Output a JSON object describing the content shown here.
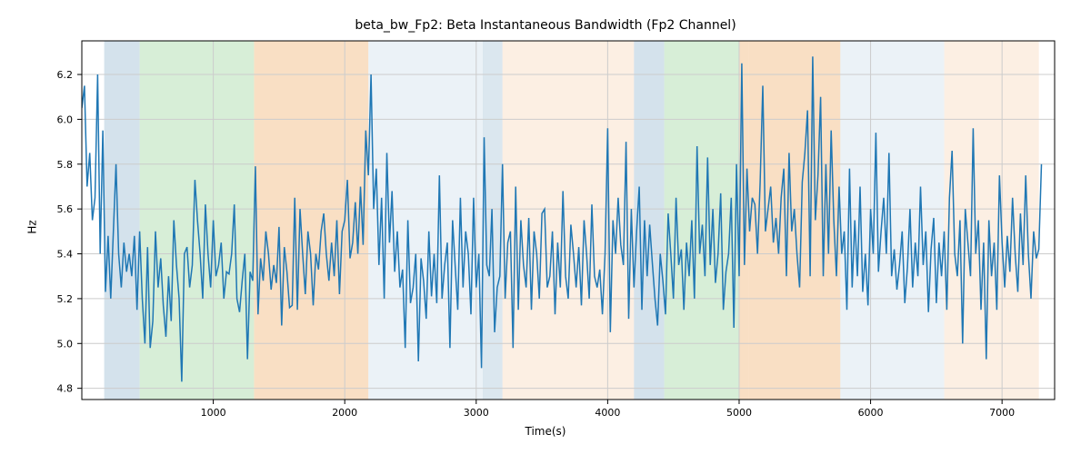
{
  "chart_data": {
    "type": "line",
    "title": "beta_bw_Fp2: Beta Instantaneous Bandwidth (Fp2 Channel)",
    "xlabel": "Time(s)",
    "ylabel": "Hz",
    "xlim": [
      0,
      7400
    ],
    "ylim": [
      4.75,
      6.35
    ],
    "xticks": [
      1000,
      2000,
      3000,
      4000,
      5000,
      6000,
      7000
    ],
    "yticks": [
      4.8,
      5.0,
      5.2,
      5.4,
      5.6,
      5.8,
      6.0,
      6.2
    ],
    "background_regions": [
      {
        "start": 170,
        "end": 440,
        "color": "#b8cfe0",
        "opacity": 0.6
      },
      {
        "start": 440,
        "end": 1310,
        "color": "#bde3bd",
        "opacity": 0.6
      },
      {
        "start": 1310,
        "end": 2180,
        "color": "#f5c99c",
        "opacity": 0.6
      },
      {
        "start": 2180,
        "end": 3050,
        "color": "#d8e5f0",
        "opacity": 0.5
      },
      {
        "start": 3050,
        "end": 3200,
        "color": "#b8cfe0",
        "opacity": 0.5
      },
      {
        "start": 3200,
        "end": 4200,
        "color": "#fae5d0",
        "opacity": 0.6
      },
      {
        "start": 4200,
        "end": 4430,
        "color": "#b8cfe0",
        "opacity": 0.6
      },
      {
        "start": 4430,
        "end": 5000,
        "color": "#bde3bd",
        "opacity": 0.6
      },
      {
        "start": 5000,
        "end": 5070,
        "color": "#f5c99c",
        "opacity": 0.6
      },
      {
        "start": 5070,
        "end": 5770,
        "color": "#f5c99c",
        "opacity": 0.6
      },
      {
        "start": 5770,
        "end": 6560,
        "color": "#d8e5f0",
        "opacity": 0.5
      },
      {
        "start": 6560,
        "end": 7280,
        "color": "#fae5d0",
        "opacity": 0.6
      }
    ],
    "x": [
      0,
      20,
      40,
      60,
      80,
      100,
      120,
      140,
      160,
      180,
      200,
      220,
      240,
      260,
      280,
      300,
      320,
      340,
      360,
      380,
      400,
      420,
      440,
      460,
      480,
      500,
      520,
      540,
      560,
      580,
      600,
      620,
      640,
      660,
      680,
      700,
      720,
      740,
      760,
      780,
      800,
      820,
      840,
      860,
      880,
      900,
      920,
      940,
      960,
      980,
      1000,
      1020,
      1040,
      1060,
      1080,
      1100,
      1120,
      1140,
      1160,
      1180,
      1200,
      1220,
      1240,
      1260,
      1280,
      1300,
      1320,
      1340,
      1360,
      1380,
      1400,
      1420,
      1440,
      1460,
      1480,
      1500,
      1520,
      1540,
      1560,
      1580,
      1600,
      1620,
      1640,
      1660,
      1680,
      1700,
      1720,
      1740,
      1760,
      1780,
      1800,
      1820,
      1840,
      1860,
      1880,
      1900,
      1920,
      1940,
      1960,
      1980,
      2000,
      2020,
      2040,
      2060,
      2080,
      2100,
      2120,
      2140,
      2160,
      2180,
      2200,
      2220,
      2240,
      2260,
      2280,
      2300,
      2320,
      2340,
      2360,
      2380,
      2400,
      2420,
      2440,
      2460,
      2480,
      2500,
      2520,
      2540,
      2560,
      2580,
      2600,
      2620,
      2640,
      2660,
      2680,
      2700,
      2720,
      2740,
      2760,
      2780,
      2800,
      2820,
      2840,
      2860,
      2880,
      2900,
      2920,
      2940,
      2960,
      2980,
      3000,
      3020,
      3040,
      3060,
      3080,
      3100,
      3120,
      3140,
      3160,
      3180,
      3200,
      3220,
      3240,
      3260,
      3280,
      3300,
      3320,
      3340,
      3360,
      3380,
      3400,
      3420,
      3440,
      3460,
      3480,
      3500,
      3520,
      3540,
      3560,
      3580,
      3600,
      3620,
      3640,
      3660,
      3680,
      3700,
      3720,
      3740,
      3760,
      3780,
      3800,
      3820,
      3840,
      3860,
      3880,
      3900,
      3920,
      3940,
      3960,
      3980,
      4000,
      4020,
      4040,
      4060,
      4080,
      4100,
      4120,
      4140,
      4160,
      4180,
      4200,
      4220,
      4240,
      4260,
      4280,
      4300,
      4320,
      4340,
      4360,
      4380,
      4400,
      4420,
      4440,
      4460,
      4480,
      4500,
      4520,
      4540,
      4560,
      4580,
      4600,
      4620,
      4640,
      4660,
      4680,
      4700,
      4720,
      4740,
      4760,
      4780,
      4800,
      4820,
      4840,
      4860,
      4880,
      4900,
      4920,
      4940,
      4960,
      4980,
      5000,
      5020,
      5040,
      5060,
      5080,
      5100,
      5120,
      5140,
      5160,
      5180,
      5200,
      5220,
      5240,
      5260,
      5280,
      5300,
      5320,
      5340,
      5360,
      5380,
      5400,
      5420,
      5440,
      5460,
      5480,
      5500,
      5520,
      5540,
      5560,
      5580,
      5600,
      5620,
      5640,
      5660,
      5680,
      5700,
      5720,
      5740,
      5760,
      5780,
      5800,
      5820,
      5840,
      5860,
      5880,
      5900,
      5920,
      5940,
      5960,
      5980,
      6000,
      6020,
      6040,
      6060,
      6080,
      6100,
      6120,
      6140,
      6160,
      6180,
      6200,
      6220,
      6240,
      6260,
      6280,
      6300,
      6320,
      6340,
      6360,
      6380,
      6400,
      6420,
      6440,
      6460,
      6480,
      6500,
      6520,
      6540,
      6560,
      6580,
      6600,
      6620,
      6640,
      6660,
      6680,
      6700,
      6720,
      6740,
      6760,
      6780,
      6800,
      6820,
      6840,
      6860,
      6880,
      6900,
      6920,
      6940,
      6960,
      6980,
      7000,
      7020,
      7040,
      7060,
      7080,
      7100,
      7120,
      7140,
      7160,
      7180,
      7200,
      7220,
      7240,
      7260,
      7280,
      7300
    ],
    "values": [
      6.05,
      6.15,
      5.7,
      5.85,
      5.55,
      5.65,
      6.2,
      5.4,
      5.95,
      5.23,
      5.48,
      5.2,
      5.5,
      5.8,
      5.4,
      5.25,
      5.45,
      5.32,
      5.4,
      5.3,
      5.48,
      5.15,
      5.5,
      5.2,
      5.0,
      5.43,
      4.98,
      5.1,
      5.5,
      5.25,
      5.38,
      5.17,
      5.03,
      5.3,
      5.1,
      5.55,
      5.35,
      5.2,
      4.83,
      5.4,
      5.43,
      5.25,
      5.35,
      5.73,
      5.55,
      5.4,
      5.2,
      5.62,
      5.4,
      5.25,
      5.55,
      5.3,
      5.35,
      5.45,
      5.2,
      5.32,
      5.31,
      5.4,
      5.62,
      5.2,
      5.14,
      5.28,
      5.4,
      4.93,
      5.32,
      5.28,
      5.79,
      5.13,
      5.38,
      5.28,
      5.5,
      5.4,
      5.24,
      5.35,
      5.27,
      5.52,
      5.08,
      5.43,
      5.32,
      5.16,
      5.17,
      5.65,
      5.15,
      5.6,
      5.4,
      5.22,
      5.5,
      5.4,
      5.17,
      5.4,
      5.33,
      5.5,
      5.58,
      5.4,
      5.28,
      5.45,
      5.3,
      5.55,
      5.22,
      5.5,
      5.55,
      5.73,
      5.38,
      5.45,
      5.63,
      5.4,
      5.7,
      5.44,
      5.95,
      5.75,
      6.2,
      5.6,
      5.78,
      5.35,
      5.65,
      5.2,
      5.85,
      5.45,
      5.68,
      5.32,
      5.5,
      5.25,
      5.33,
      4.98,
      5.55,
      5.18,
      5.25,
      5.4,
      4.92,
      5.38,
      5.28,
      5.11,
      5.5,
      5.21,
      5.4,
      5.18,
      5.75,
      5.2,
      5.35,
      5.45,
      4.98,
      5.55,
      5.35,
      5.15,
      5.65,
      5.25,
      5.5,
      5.4,
      5.13,
      5.65,
      5.25,
      5.4,
      4.89,
      5.92,
      5.35,
      5.3,
      5.6,
      5.05,
      5.25,
      5.3,
      5.8,
      5.2,
      5.45,
      5.5,
      4.98,
      5.7,
      5.15,
      5.55,
      5.35,
      5.25,
      5.56,
      5.15,
      5.5,
      5.4,
      5.2,
      5.58,
      5.6,
      5.25,
      5.3,
      5.5,
      5.13,
      5.45,
      5.25,
      5.68,
      5.3,
      5.2,
      5.53,
      5.4,
      5.25,
      5.43,
      5.17,
      5.55,
      5.4,
      5.2,
      5.62,
      5.3,
      5.25,
      5.33,
      5.13,
      5.4,
      5.96,
      5.05,
      5.55,
      5.4,
      5.65,
      5.44,
      5.35,
      5.9,
      5.11,
      5.6,
      5.25,
      5.5,
      5.7,
      5.15,
      5.55,
      5.3,
      5.53,
      5.36,
      5.2,
      5.08,
      5.4,
      5.28,
      5.13,
      5.58,
      5.4,
      5.2,
      5.65,
      5.35,
      5.42,
      5.15,
      5.45,
      5.3,
      5.55,
      5.2,
      5.88,
      5.4,
      5.53,
      5.3,
      5.83,
      5.35,
      5.6,
      5.27,
      5.4,
      5.67,
      5.15,
      5.32,
      5.4,
      5.65,
      5.07,
      5.8,
      5.3,
      6.25,
      5.35,
      5.78,
      5.5,
      5.65,
      5.62,
      5.4,
      5.72,
      6.15,
      5.5,
      5.6,
      5.7,
      5.45,
      5.56,
      5.4,
      5.65,
      5.78,
      5.3,
      5.85,
      5.5,
      5.6,
      5.4,
      5.25,
      5.72,
      5.85,
      6.04,
      5.3,
      6.28,
      5.55,
      5.75,
      6.1,
      5.3,
      5.8,
      5.4,
      5.95,
      5.55,
      5.3,
      5.7,
      5.4,
      5.5,
      5.15,
      5.78,
      5.25,
      5.55,
      5.3,
      5.7,
      5.23,
      5.4,
      5.17,
      5.6,
      5.4,
      5.94,
      5.32,
      5.5,
      5.65,
      5.4,
      5.85,
      5.3,
      5.42,
      5.24,
      5.35,
      5.5,
      5.18,
      5.34,
      5.6,
      5.25,
      5.45,
      5.3,
      5.7,
      5.35,
      5.5,
      5.14,
      5.42,
      5.56,
      5.18,
      5.45,
      5.3,
      5.5,
      5.15,
      5.65,
      5.86,
      5.4,
      5.3,
      5.55,
      5.0,
      5.6,
      5.45,
      5.3,
      5.96,
      5.4,
      5.55,
      5.15,
      5.45,
      4.93,
      5.55,
      5.3,
      5.45,
      5.15,
      5.75,
      5.45,
      5.25,
      5.48,
      5.32,
      5.65,
      5.4,
      5.23,
      5.58,
      5.35,
      5.75,
      5.4,
      5.2,
      5.5,
      5.38,
      5.42,
      5.8
    ]
  }
}
